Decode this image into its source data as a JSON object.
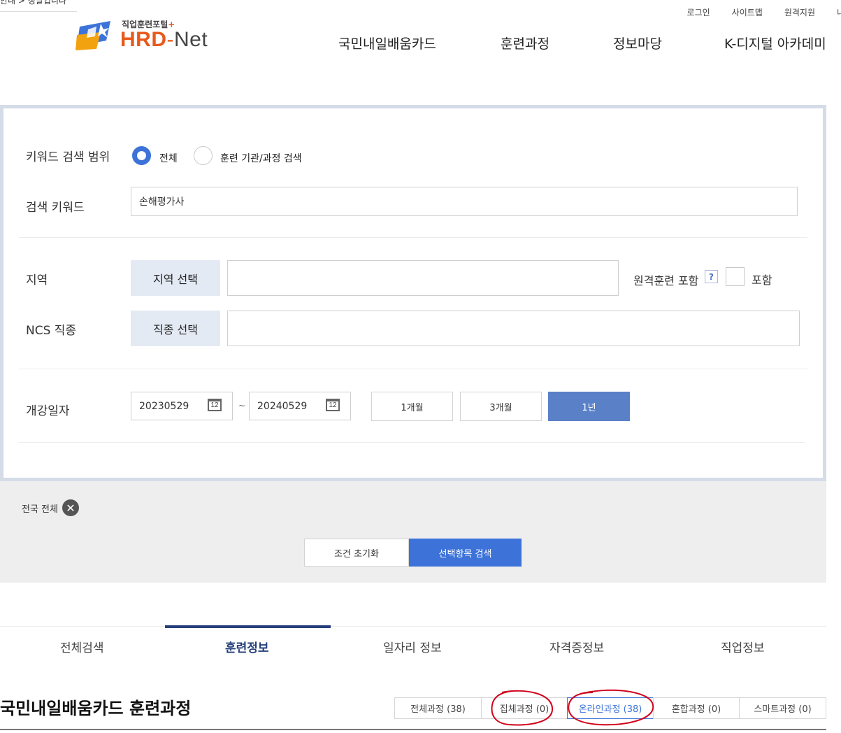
{
  "top": {
    "breadcrumb": "안내 > 정말입니다",
    "util_links": [
      "로그인",
      "사이트맵",
      "원격지원",
      "내"
    ]
  },
  "logo": {
    "sub": "직업훈련포털",
    "plus": "+",
    "hrd": "HRD",
    "dash": "-",
    "net": "Net"
  },
  "gnb": [
    "국민내일배움카드",
    "훈련과정",
    "정보마당",
    "K-디지털 아카데미"
  ],
  "search_form": {
    "scope_label": "키워드 검색 범위",
    "scope_options": [
      {
        "label": "전체",
        "selected": true
      },
      {
        "label": "훈련 기관/과정 검색",
        "selected": false
      }
    ],
    "keyword_label": "검색 키워드",
    "keyword_value": "손해평가사",
    "region_label": "지역",
    "region_button": "지역 선택",
    "remote_label": "원격훈련 포함",
    "remote_help": "?",
    "remote_check_label": "포함",
    "ncs_label": "NCS 직종",
    "ncs_button": "직종 선택",
    "date_label": "개강일자",
    "date_from": "20230529",
    "date_to": "20240529",
    "date_sep": "~",
    "calendar_glyph": "12",
    "periods": [
      {
        "label": "1개월",
        "active": false
      },
      {
        "label": "3개월",
        "active": false
      },
      {
        "label": "1년",
        "active": true
      }
    ]
  },
  "filter_chip": {
    "label": "전국 전체",
    "remove": "✕"
  },
  "actions": {
    "reset": "조건 초기화",
    "search": "선택항목 검색"
  },
  "tabs": [
    {
      "label": "전체검색",
      "active": false
    },
    {
      "label": "훈련정보",
      "active": true
    },
    {
      "label": "일자리 정보",
      "active": false
    },
    {
      "label": "자격증정보",
      "active": false
    },
    {
      "label": "직업정보",
      "active": false
    }
  ],
  "results": {
    "title": "국민내일배움카드 훈련과정",
    "filter_tabs": [
      {
        "label": "전체과정 (38)",
        "active": false
      },
      {
        "label": "집체과정 (0)",
        "active": false
      },
      {
        "label": "온라인과정 (38)",
        "active": true
      },
      {
        "label": "혼합과정 (0)",
        "active": false
      },
      {
        "label": "스마트과정 (0)",
        "active": false
      }
    ]
  },
  "colors": {
    "accent": "#3d73d9",
    "brand_orange": "#e8591c",
    "panel_border": "#d5dce8",
    "period_active": "#5a80c8",
    "tab_active": "#253f7a",
    "annotation": "#d0021b"
  }
}
